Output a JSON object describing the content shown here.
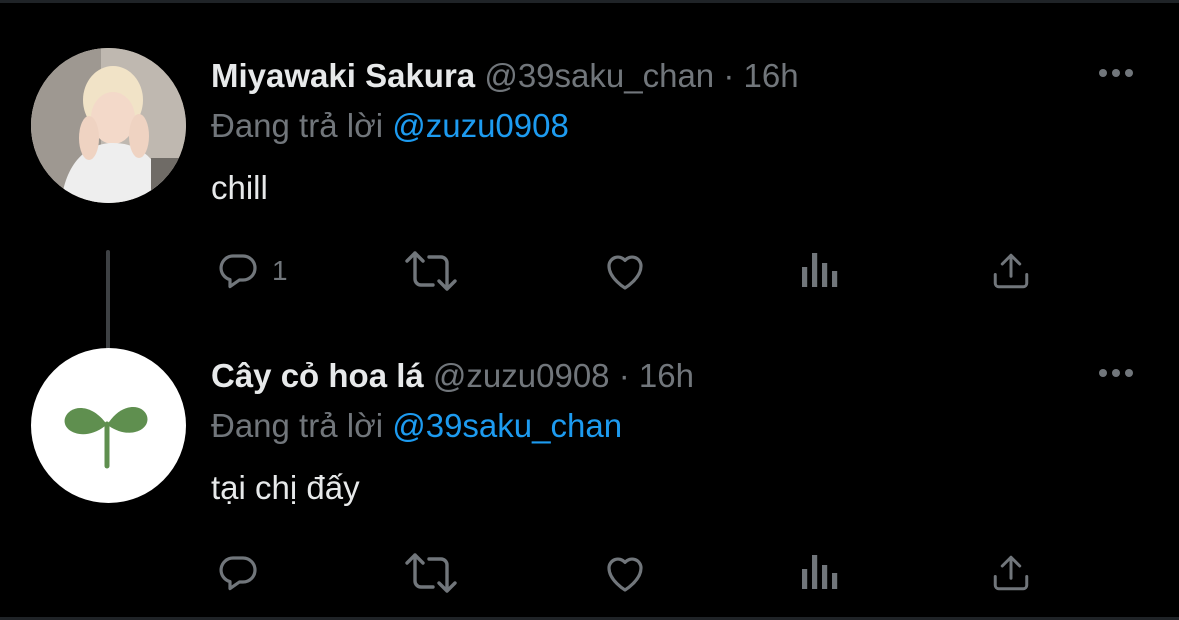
{
  "tweets": [
    {
      "name": "Miyawaki Sakura",
      "handle": "@39saku_chan",
      "separator": "·",
      "time": "16h",
      "reply_prefix": "Đang trả lời",
      "reply_mention": "@zuzu0908",
      "text": "chill",
      "reply_count": "1",
      "avatar": "photo"
    },
    {
      "name": "Cây cỏ hoa lá",
      "handle": "@zuzu0908",
      "separator": "·",
      "time": "16h",
      "reply_prefix": "Đang trả lời",
      "reply_mention": "@39saku_chan",
      "text": "tại chị đấy",
      "reply_count": "",
      "avatar": "sprout-logo"
    }
  ],
  "icons": {
    "reply": "reply-icon",
    "retweet": "retweet-icon",
    "like": "heart-icon",
    "views": "views-icon",
    "share": "share-icon",
    "more": "more-icon"
  },
  "colors": {
    "background": "#000000",
    "text": "#e7e9ea",
    "secondary": "#71767b",
    "link": "#1d9bf0",
    "icon": "#71767b"
  }
}
